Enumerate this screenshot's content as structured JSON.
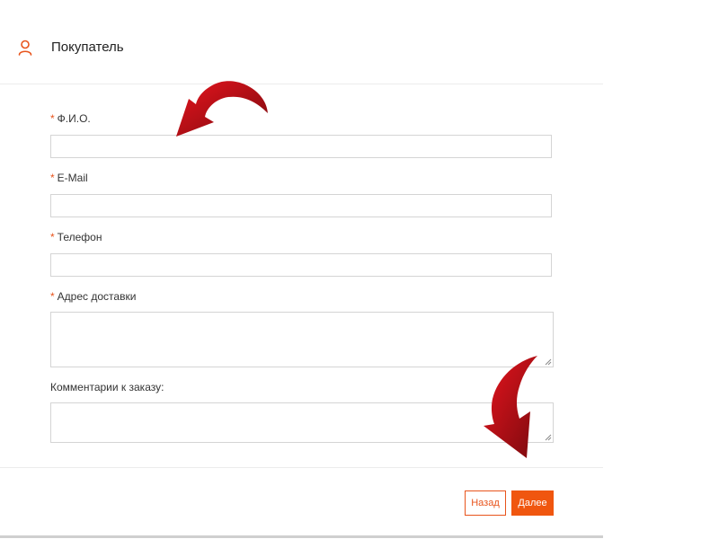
{
  "header": {
    "title": "Покупатель",
    "icon": "user-icon"
  },
  "form": {
    "required_mark": "*",
    "fields": [
      {
        "label": "Ф.И.О.",
        "required": true,
        "value": ""
      },
      {
        "label": "E-Mail",
        "required": true,
        "value": ""
      },
      {
        "label": "Телефон",
        "required": true,
        "value": ""
      },
      {
        "label": "Адрес доставки",
        "required": true,
        "value": ""
      },
      {
        "label": "Комментарии к заказу:",
        "required": false,
        "value": ""
      }
    ]
  },
  "footer": {
    "back_label": "Назад",
    "next_label": "Далее"
  },
  "colors": {
    "accent": "#f0560f",
    "required": "#e8541c",
    "annotation_arrow": "#c8101a"
  }
}
